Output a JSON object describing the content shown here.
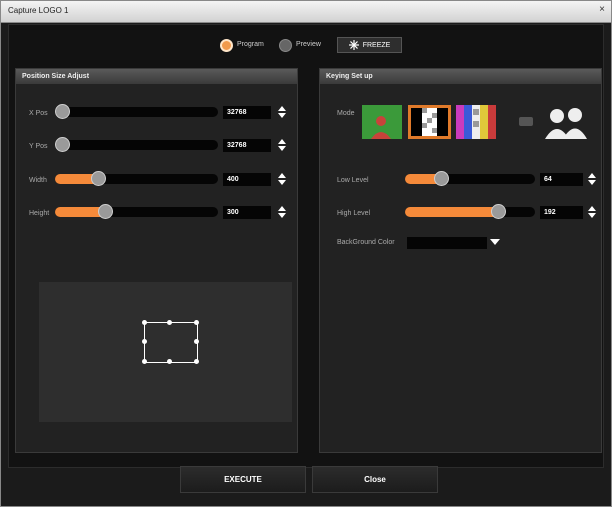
{
  "window": {
    "title": "Capture LOGO 1",
    "close_glyph": "×"
  },
  "source": {
    "program_label": "Program",
    "preview_label": "Preview",
    "selected": "Program",
    "freeze_label": "FREEZE",
    "freeze_icon": "snowflake-icon"
  },
  "position_panel": {
    "title": "Position Size Adjust",
    "sliders": [
      {
        "label": "X Pos",
        "value": "32768",
        "fraction": 0.0
      },
      {
        "label": "Y Pos",
        "value": "32768",
        "fraction": 0.0
      },
      {
        "label": "Width",
        "value": "400",
        "fraction": 0.24
      },
      {
        "label": "Height",
        "value": "300",
        "fraction": 0.29
      }
    ]
  },
  "keying_panel": {
    "title": "Keying Set up",
    "mode_label": "Mode",
    "modes": [
      "green-screen",
      "luma-checker",
      "color-checker",
      "person-silhouette"
    ],
    "selected_mode": "luma-checker",
    "low_level": {
      "label": "Low Level",
      "value": "64",
      "fraction": 0.25
    },
    "high_level": {
      "label": "High Level",
      "value": "192",
      "fraction": 0.75
    },
    "background_color_label": "BackGround Color"
  },
  "buttons": {
    "execute": "EXECUTE",
    "close": "Close"
  },
  "colors": {
    "accent": "#f58a3a",
    "panel": "#222222"
  }
}
